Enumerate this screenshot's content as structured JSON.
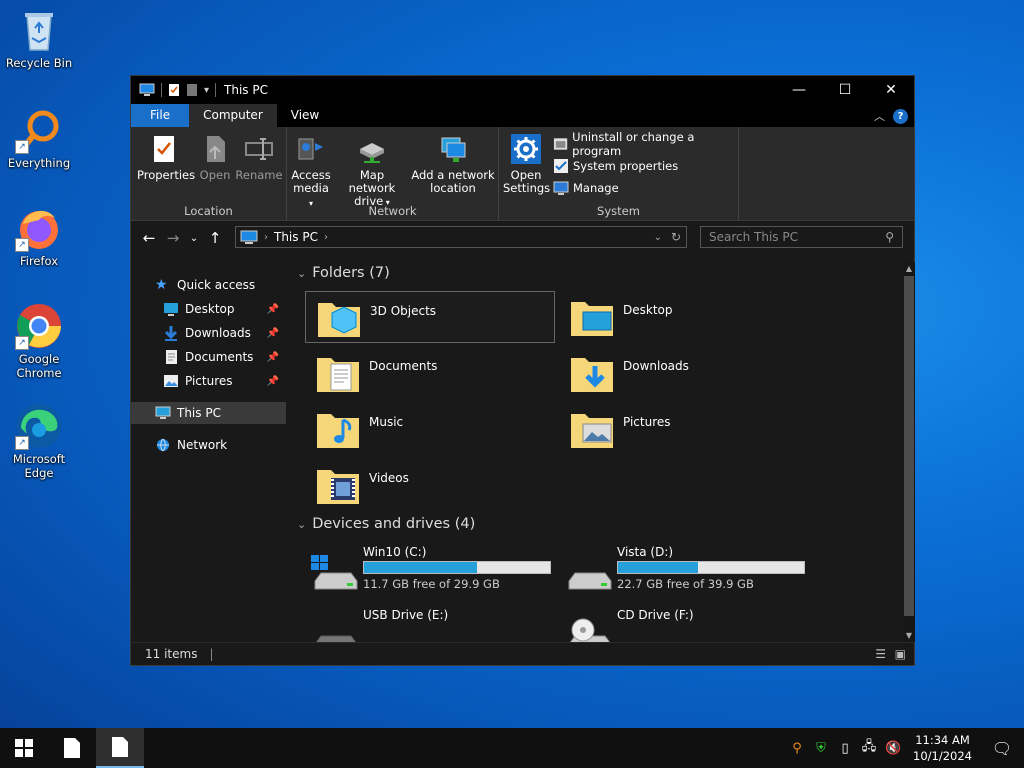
{
  "desktop": {
    "icons": [
      {
        "label": "Recycle Bin"
      },
      {
        "label": "Everything"
      },
      {
        "label": "Firefox"
      },
      {
        "label": "Google Chrome"
      },
      {
        "label": "Microsoft Edge"
      }
    ]
  },
  "window": {
    "title": "This PC",
    "tabs": {
      "file": "File",
      "computer": "Computer",
      "view": "View"
    },
    "ribbon": {
      "location": {
        "label": "Location",
        "properties": "Properties",
        "open": "Open",
        "rename": "Rename"
      },
      "network": {
        "label": "Network",
        "access_media": "Access media",
        "map_drive": "Map network drive",
        "add_location": "Add a network location"
      },
      "system": {
        "label": "System",
        "open_settings": "Open Settings",
        "uninstall": "Uninstall or change a program",
        "sys_props": "System properties",
        "manage": "Manage"
      }
    },
    "address": {
      "path": "This PC",
      "search_placeholder": "Search This PC"
    },
    "nav": {
      "quick_access": "Quick access",
      "desktop": "Desktop",
      "downloads": "Downloads",
      "documents": "Documents",
      "pictures": "Pictures",
      "this_pc": "This PC",
      "network": "Network"
    },
    "folders_header": "Folders (7)",
    "folders": [
      {
        "name": "3D Objects"
      },
      {
        "name": "Desktop"
      },
      {
        "name": "Documents"
      },
      {
        "name": "Downloads"
      },
      {
        "name": "Music"
      },
      {
        "name": "Pictures"
      },
      {
        "name": "Videos"
      }
    ],
    "drives_header": "Devices and drives (4)",
    "drives": [
      {
        "name": "Win10 (C:)",
        "free": "11.7 GB free of 29.9 GB",
        "used_fraction": 0.61
      },
      {
        "name": "Vista (D:)",
        "free": "22.7 GB free of 39.9 GB",
        "used_fraction": 0.43
      },
      {
        "name": "USB Drive (E:)"
      },
      {
        "name": "CD Drive (F:)"
      }
    ],
    "status": "11 items"
  },
  "taskbar": {
    "time": "11:34 AM",
    "date": "10/1/2024"
  },
  "colors": {
    "accent": "#1a6fc8",
    "drive_bar": "#26a0da",
    "folder": "#f5d77a"
  }
}
